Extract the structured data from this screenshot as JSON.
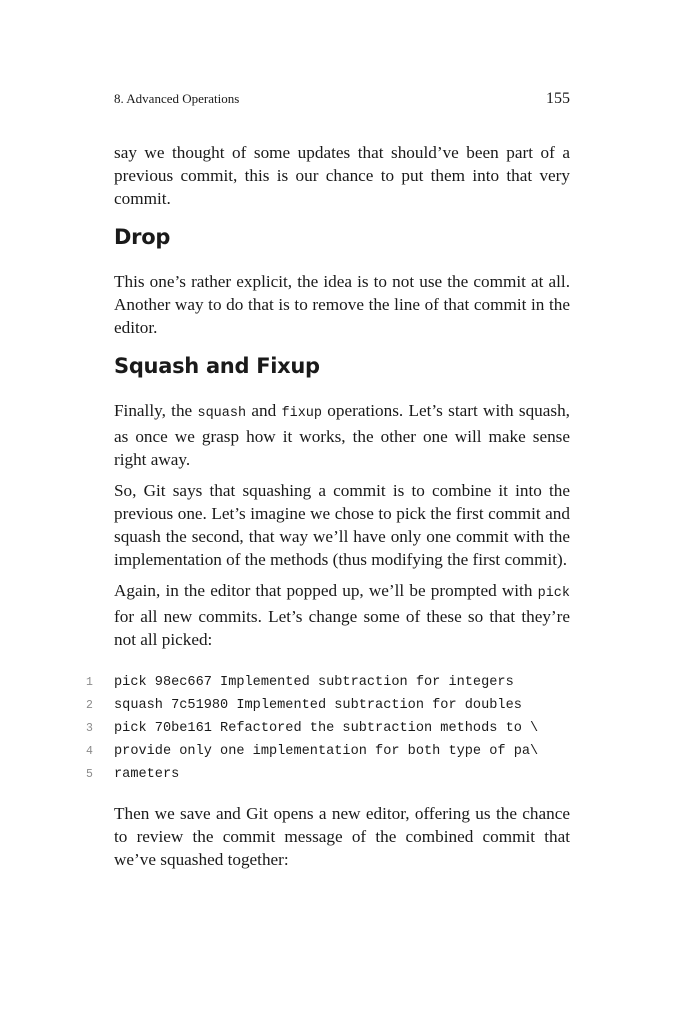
{
  "header": {
    "chapter": "8. Advanced Operations",
    "page_number": "155"
  },
  "paragraphs": {
    "p1": "say we thought of some updates that should’ve been part of a previous commit, this is our chance to put them into that very commit.",
    "drop_heading": "Drop",
    "p2": "This one’s rather explicit, the idea is to not use the commit at all. Another way to do that is to remove the line of that commit in the editor.",
    "squash_heading": "Squash and Fixup",
    "p3_a": "Finally, the ",
    "p3_code1": "squash",
    "p3_b": " and ",
    "p3_code2": "fixup",
    "p3_c": " operations. Let’s start with squash, as once we grasp how it works, the other one will make sense right away.",
    "p4": "So, Git says that squashing a commit is to combine it into the previous one. Let’s imagine we chose to pick the first commit and squash the second, that way we’ll have only one commit with the implementation of the methods (thus modifying the first commit).",
    "p5_a": "Again, in the editor that popped up, we’ll be prompted with ",
    "p5_code": "pick",
    "p5_b": " for all new commits. Let’s change some of these so that they’re not all picked:",
    "p6": "Then we save and Git opens a new editor, offering us the chance to review the commit message of the combined commit that we’ve squashed together:"
  },
  "code_lines": [
    {
      "num": "1",
      "text": "pick 98ec667 Implemented subtraction for integers"
    },
    {
      "num": "2",
      "text": "squash 7c51980 Implemented subtraction for doubles"
    },
    {
      "num": "3",
      "text": "pick 70be161 Refactored the subtraction methods to \\"
    },
    {
      "num": "4",
      "text": "provide only one implementation for both type of pa\\"
    },
    {
      "num": "5",
      "text": "rameters"
    }
  ]
}
